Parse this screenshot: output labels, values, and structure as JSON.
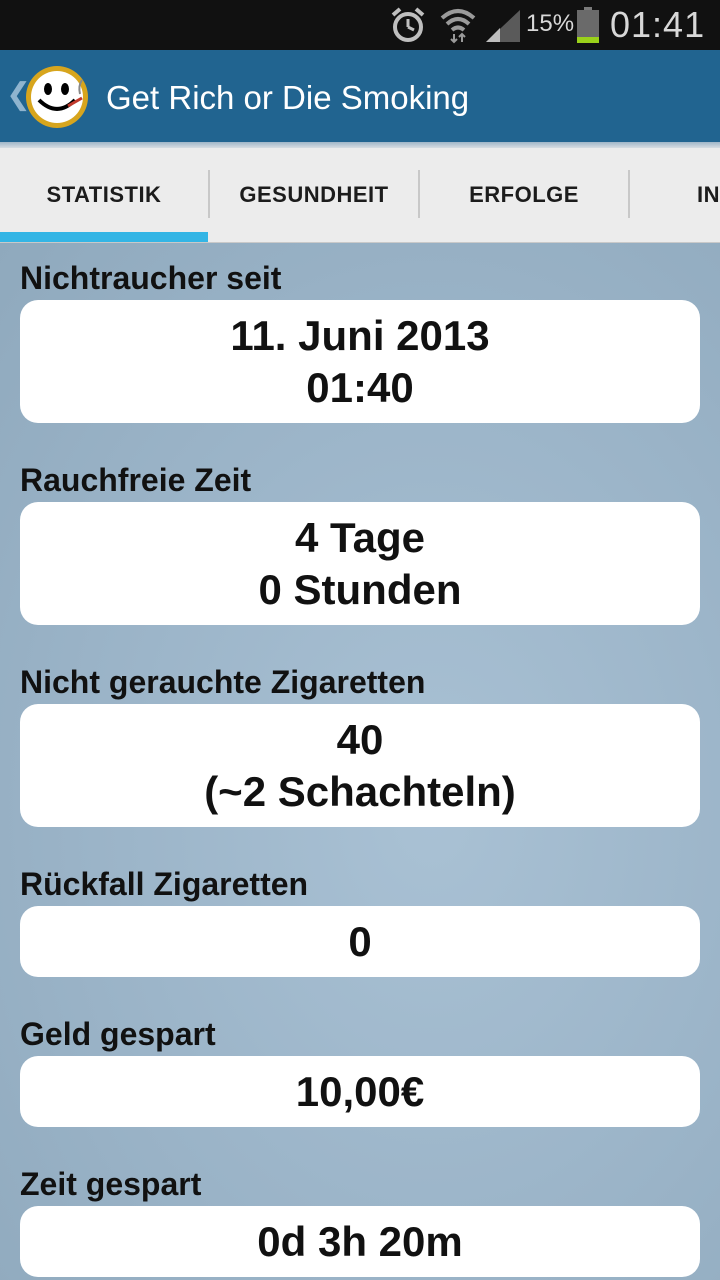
{
  "status_bar": {
    "battery_percent": "15%",
    "time": "01:41",
    "icons": [
      "alarm-icon",
      "wifi-icon",
      "signal-icon",
      "battery-icon"
    ]
  },
  "action_bar": {
    "title": "Get Rich or Die Smoking",
    "back_icon": "chevron-left-icon",
    "logo": "smiley-smoking-logo"
  },
  "tabs": [
    {
      "label": "STATISTIK",
      "selected": true
    },
    {
      "label": "GESUNDHEIT",
      "selected": false
    },
    {
      "label": "ERFOLGE",
      "selected": false
    },
    {
      "label": "IN",
      "selected": false
    }
  ],
  "stats": {
    "nonsmoker_since": {
      "label": "Nichtraucher seit",
      "line1": "11. Juni 2013",
      "line2": "01:40"
    },
    "smokefree_time": {
      "label": "Rauchfreie Zeit",
      "line1": "4 Tage",
      "line2": "0 Stunden"
    },
    "cigarettes_not_smoked": {
      "label": "Nicht gerauchte Zigaretten",
      "line1": "40",
      "line2": "(~2 Schachteln)"
    },
    "relapse_cigarettes": {
      "label": "Rückfall Zigaretten",
      "value": "0"
    },
    "money_saved": {
      "label": "Geld gespart",
      "value": "10,00€"
    },
    "time_saved": {
      "label": "Zeit gespart",
      "value": "0d 3h 20m"
    }
  },
  "colors": {
    "action_bar": "#216490",
    "tab_indicator": "#33b5e5",
    "background": "#9fb8cc"
  }
}
